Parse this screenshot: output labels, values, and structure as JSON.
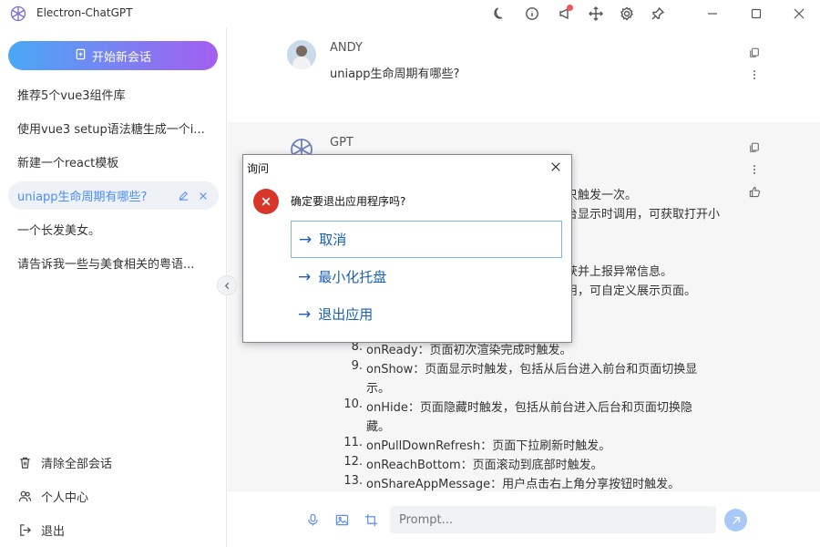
{
  "window": {
    "title": "Electron-ChatGPT"
  },
  "toolbar": {
    "icons": [
      "moon-icon",
      "info-icon",
      "megaphone-icon",
      "move-icon",
      "gear-icon",
      "pin-icon",
      "minimize-icon",
      "maximize-icon",
      "close-icon"
    ]
  },
  "sidebar": {
    "new_chat_label": "开始新会话",
    "items": [
      {
        "label": "推荐5个vue3组件库",
        "active": false
      },
      {
        "label": "使用vue3 setup语法糖生成一个i...",
        "active": false
      },
      {
        "label": "新建一个react模板",
        "active": false
      },
      {
        "label": "uniapp生命周期有哪些?",
        "active": true
      },
      {
        "label": "一个长发美女。",
        "active": false
      },
      {
        "label": "请告诉我一些与美食相关的粤语...",
        "active": false
      }
    ],
    "footer": {
      "clear_label": "清除全部会话",
      "profile_label": "个人中心",
      "logout_label": "退出"
    }
  },
  "chat": {
    "user": {
      "name": "ANDY",
      "message": "uniapp生命周期有哪些?"
    },
    "gpt": {
      "name": "GPT",
      "fragments": [
        "只触发一次。",
        "台显示时调用，可获取打开小",
        "。",
        "获并上报异常信息。",
        "用，可自定义展示页面。"
      ],
      "items": [
        {
          "num": "8.",
          "text": "onReady：页面初次渲染完成时触发。"
        },
        {
          "num": "9.",
          "text": "onShow：页面显示时触发，包括从后台进入前台和页面切换显"
        },
        {
          "num": "",
          "text": "示。"
        },
        {
          "num": "10.",
          "text": "onHide：页面隐藏时触发，包括从前台进入后台和页面切换隐"
        },
        {
          "num": "",
          "text": "藏。"
        },
        {
          "num": "11.",
          "text": "onPullDownRefresh：页面下拉刷新时触发。"
        },
        {
          "num": "12.",
          "text": "onReachBottom：页面滚动到底部时触发。"
        },
        {
          "num": "13.",
          "text": "onShareAppMessage：用户点击右上角分享按钮时触发。"
        }
      ]
    }
  },
  "input": {
    "placeholder": "Prompt..."
  },
  "dialog": {
    "title": "询问",
    "message": "确定要退出应用程序吗?",
    "options": [
      {
        "label": "取消",
        "focused": true
      },
      {
        "label": "最小化托盘",
        "focused": false
      },
      {
        "label": "退出应用",
        "focused": false
      }
    ]
  },
  "colors": {
    "accent": "#4a8ef5",
    "gradient_start": "#4aa8f5",
    "gradient_end": "#a45ef0",
    "error": "#d9362b",
    "notification": "#f25757"
  }
}
